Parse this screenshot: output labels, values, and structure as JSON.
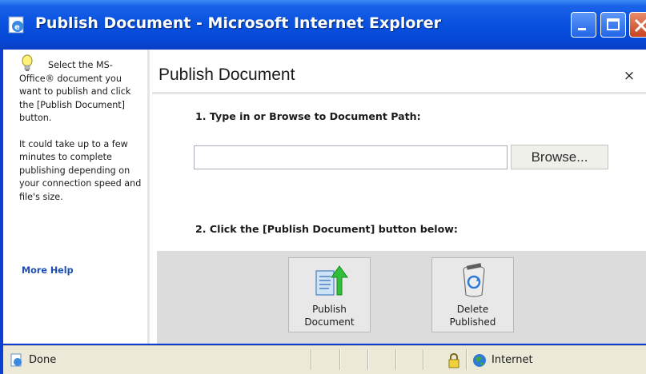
{
  "window": {
    "title": "Publish Document - Microsoft Internet Explorer",
    "minimize_icon": "minimize-icon",
    "maximize_icon": "maximize-icon",
    "close_icon": "close-icon"
  },
  "sidebar": {
    "help_paragraph_1": "Select the MS-Office® document you want to publish and click the [Publish Document] button.",
    "help_paragraph_2": "It could take up to a few minutes to complete publishing depending on your connection speed and file's size.",
    "more_help_link": "More Help",
    "icon": "lightbulb-icon"
  },
  "main": {
    "title": "Publish Document",
    "close_symbol": "×",
    "step1_label": "1. Type in or Browse to Document Path:",
    "path_input_value": "",
    "browse_button": "Browse...",
    "step2_label": "2. Click the [Publish Document] button below:",
    "actions": [
      {
        "label_line1": "Publish",
        "label_line2": "Document",
        "icon": "publish-document-icon"
      },
      {
        "label_line1": "Delete",
        "label_line2": "Published",
        "icon": "recycle-bin-icon"
      }
    ]
  },
  "statusbar": {
    "status": "Done",
    "zone": "Internet",
    "colors": {
      "bar": "#ece9d8"
    }
  },
  "colors": {
    "titlebar": "#0a52e0",
    "link": "#1c4fb5",
    "panel": "#dcdcdc"
  }
}
